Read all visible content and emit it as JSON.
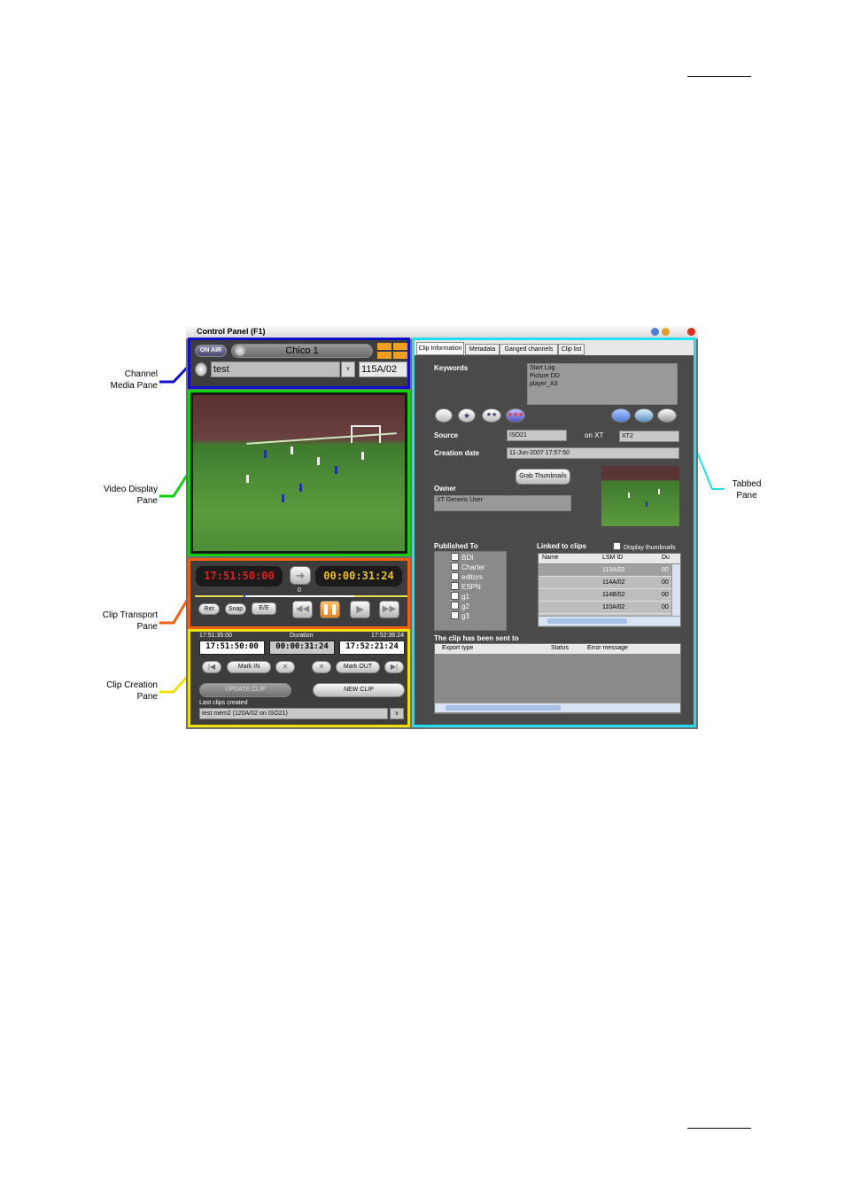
{
  "window": {
    "title": "Control Panel (F1)"
  },
  "callouts": {
    "channel_media": [
      "Channel",
      "Media Pane"
    ],
    "video_display": [
      "Video Display",
      "Pane"
    ],
    "clip_transport": [
      "Clip Transport",
      "Pane"
    ],
    "clip_creation": [
      "Clip Creation",
      "Pane"
    ],
    "tabbed": [
      "Tabbed",
      "Pane"
    ]
  },
  "channel_media": {
    "on_air": "ON AIR",
    "channel_name": "Chico 1",
    "clip_name": "test",
    "dropdown": "v",
    "clip_id": "115A/02"
  },
  "transport": {
    "timecode_left": "17:51:50:00",
    "timecode_right": "00:00:31:24",
    "position": "0",
    "ret": "Ret",
    "snap": "Snap",
    "ee": "E/E",
    "colors": {
      "left_tc": "#e02020",
      "right_tc": "#f0c020",
      "pause": "#f0a030"
    }
  },
  "creation": {
    "tc_in_label": "17:51:35:00",
    "duration_label": "Duration",
    "tc_out_label": "17:52:36:24",
    "tc_in": "17:51:50:00",
    "duration": "00:00:31:24",
    "tc_out": "17:52:21:24",
    "mark_in": "Mark IN",
    "mark_out": "Mark OUT",
    "update_clip": "UPDATE CLIP",
    "new_clip": "NEW CLIP",
    "last_clips_label": "Last clips created",
    "last_clip": "test mem2 (120A/02 on ISO21)",
    "dropdown": "v"
  },
  "tabs": [
    "Clip Information",
    "Metadata",
    "Ganged channels",
    "Clip list"
  ],
  "clip_info": {
    "keywords_label": "Keywords",
    "keywords": [
      "Start Log",
      "Picture DD",
      "player_A3"
    ],
    "source_label": "Source",
    "source": "ISO21",
    "on_xt_label": "on XT",
    "on_xt": "XT2",
    "creation_date_label": "Creation date",
    "creation_date": "11-Jun-2007 17:57:50",
    "grab_thumbnails": "Grab Thumbnails",
    "owner_label": "Owner",
    "owner": "XT Generic User",
    "published_to_label": "Published To",
    "published_to": [
      "BDI",
      "Charter",
      "editors",
      "ESPN",
      "g1",
      "g2",
      "g3"
    ],
    "linked_label": "Linked to clips",
    "display_thumbnails": "Display thumbnails",
    "linked_columns": [
      "Name",
      "LSM ID",
      "Du"
    ],
    "linked_rows": [
      {
        "name": "",
        "lsm_id": "113A/02",
        "du": "00"
      },
      {
        "name": "",
        "lsm_id": "114A/02",
        "du": "00"
      },
      {
        "name": "",
        "lsm_id": "114B/02",
        "du": "00"
      },
      {
        "name": "",
        "lsm_id": "110A/02",
        "du": "00"
      }
    ],
    "sent_to_label": "The clip has been sent to",
    "sent_columns": [
      "Export type",
      "Status",
      "Error message"
    ]
  },
  "pane_colors": {
    "channel_media": "#1010c8",
    "video_display": "#10d010",
    "clip_transport": "#f06010",
    "clip_creation": "#f0e010",
    "tabbed": "#20e0f0"
  }
}
